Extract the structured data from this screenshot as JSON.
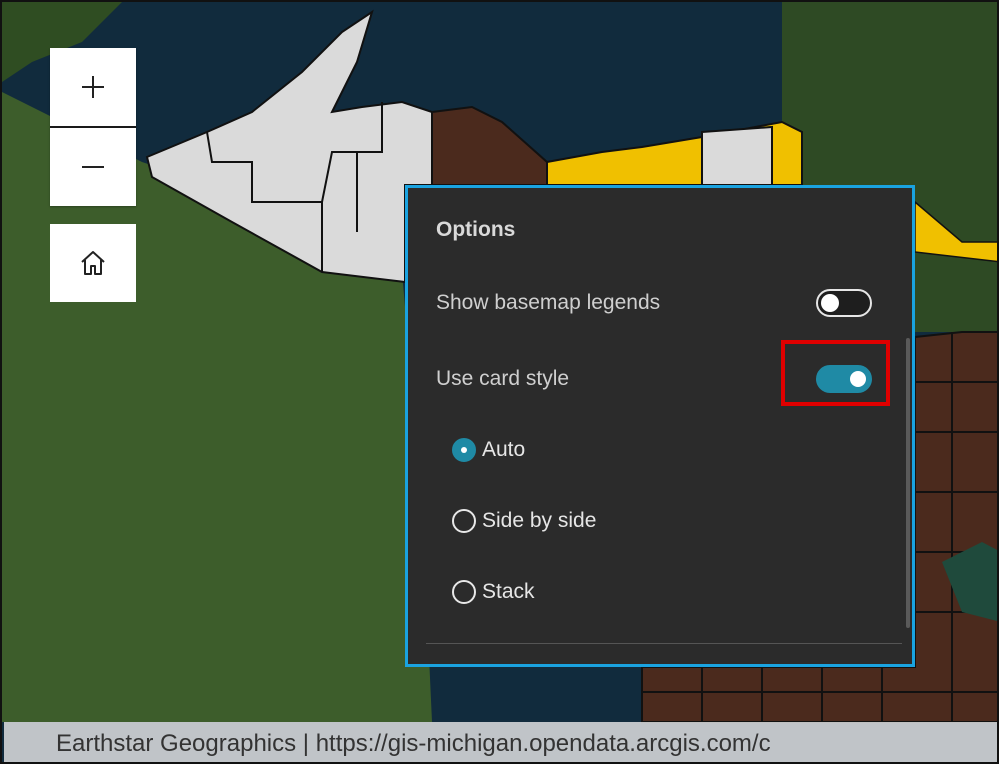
{
  "map": {
    "zoom_in_icon": "plus-icon",
    "zoom_out_icon": "minus-icon",
    "home_icon": "home-icon",
    "attribution": "Earthstar Geographics | https://gis-michigan.opendata.arcgis.com/c",
    "colors": {
      "water": "#112b3d",
      "land": "#3b5a2a",
      "county_white": "#dadada",
      "county_brown": "#4b2a1d",
      "county_yellow": "#f0c000"
    }
  },
  "options_panel": {
    "title": "Options",
    "show_basemap_legends": {
      "label": "Show basemap legends",
      "enabled": false
    },
    "use_card_style": {
      "label": "Use card style",
      "enabled": true
    },
    "layout_options": [
      {
        "label": "Auto",
        "selected": true
      },
      {
        "label": "Side by side",
        "selected": false
      },
      {
        "label": "Stack",
        "selected": false
      }
    ],
    "colors": {
      "background": "#2b2b2b",
      "border": "#1aa3e0",
      "accent": "#1f8aa5",
      "highlight": "#e00000"
    }
  }
}
